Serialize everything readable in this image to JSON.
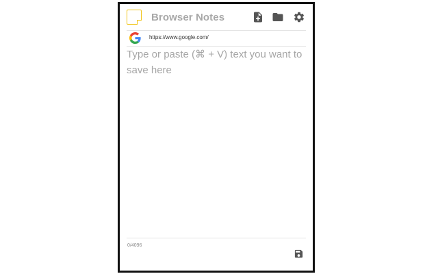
{
  "app": {
    "title": "Browser Notes"
  },
  "header": {
    "icons": [
      "new-note-icon",
      "folder-icon",
      "gear-icon"
    ],
    "icon_color": "#555555"
  },
  "url_bar": {
    "site_icon": "google-icon",
    "url": "https://www.google.com/"
  },
  "editor": {
    "value": "",
    "placeholder": "Type or paste (⌘ + V) text you want to save here"
  },
  "footer": {
    "char_count": "0/4096",
    "save_icon": "save-icon"
  },
  "colors": {
    "logo_accent": "#f0c419",
    "title_text": "#a8a8a8",
    "border": "#111111"
  }
}
